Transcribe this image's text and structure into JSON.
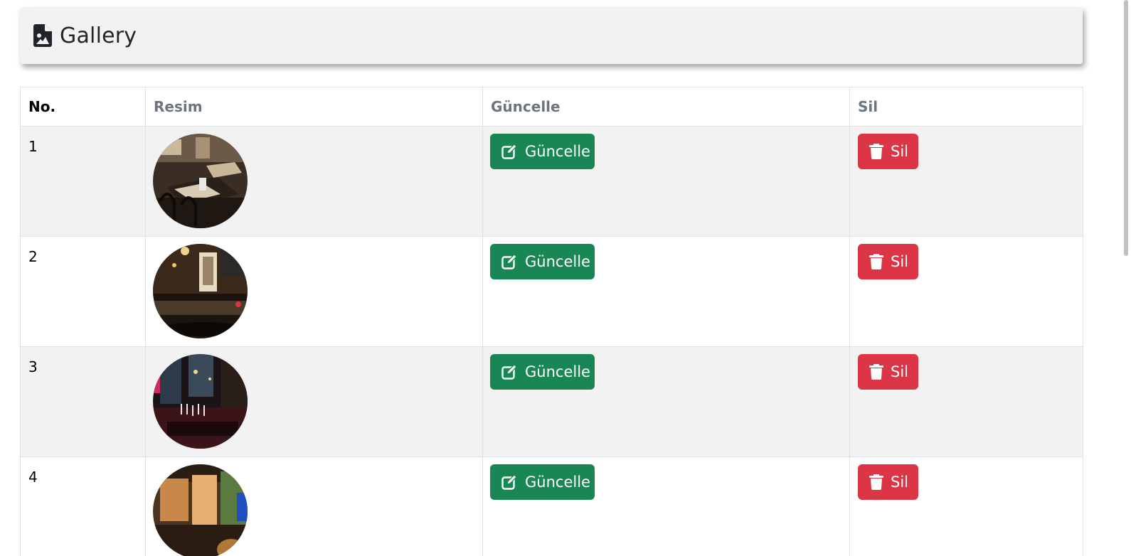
{
  "header": {
    "title": "Gallery",
    "icon": "file-image-icon"
  },
  "table": {
    "columns": [
      "No.",
      "Resim",
      "Güncelle",
      "Sil"
    ],
    "rows": [
      {
        "no": "1",
        "image": "restaurant-interior-1",
        "update_label": "Güncelle",
        "delete_label": "Sil"
      },
      {
        "no": "2",
        "image": "restaurant-interior-2",
        "update_label": "Güncelle",
        "delete_label": "Sil"
      },
      {
        "no": "3",
        "image": "restaurant-interior-3",
        "update_label": "Güncelle",
        "delete_label": "Sil"
      },
      {
        "no": "4",
        "image": "restaurant-interior-4",
        "update_label": "Güncelle",
        "delete_label": "Sil"
      }
    ]
  },
  "colors": {
    "update_button": "#198754",
    "delete_button": "#dc3545",
    "stripe": "#f2f2f2"
  }
}
